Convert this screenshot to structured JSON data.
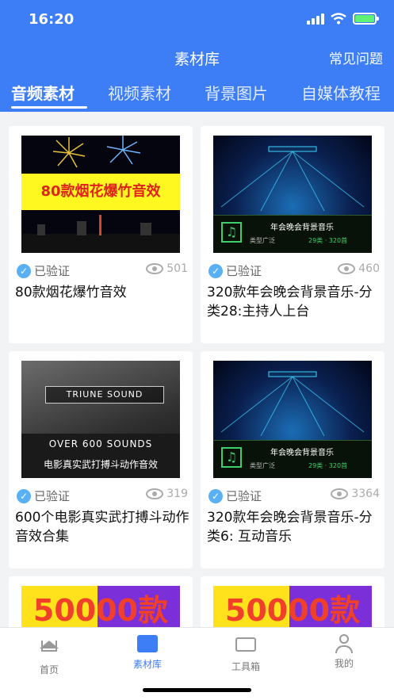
{
  "status_bar": {
    "time": "16:20"
  },
  "nav": {
    "title": "素材库",
    "faq": "常见问题"
  },
  "tabs": [
    {
      "label": "音频素材",
      "active": true
    },
    {
      "label": "视频素材",
      "active": false
    },
    {
      "label": "背景图片",
      "active": false
    },
    {
      "label": "自媒体教程",
      "active": false
    }
  ],
  "cards": [
    {
      "thumb_text": "80款烟花爆竹音效",
      "verified": "已验证",
      "views": "501",
      "title": "80款烟花爆竹音效"
    },
    {
      "thumb_text": "年会晚会背景音乐",
      "thumb_sub1": "类型广泛",
      "thumb_sub2": "29类 · 320首",
      "verified": "已验证",
      "views": "460",
      "title": "320款年会晚会背景音乐-分类28:主持人上台"
    },
    {
      "thumb_text": "TRIUNE SOUND",
      "thumb_sub1": "OVER 600 SOUNDS",
      "thumb_sub2": "电影真实武打搏斗动作音效",
      "verified": "已验证",
      "views": "319",
      "title": "600个电影真实武打搏斗动作音效合集"
    },
    {
      "thumb_text": "年会晚会背景音乐",
      "thumb_sub1": "类型广泛",
      "thumb_sub2": "29类 · 320首",
      "verified": "已验证",
      "views": "3364",
      "title": "320款年会晚会背景音乐-分类6: 互动音乐"
    },
    {
      "thumb_text": "50000款"
    },
    {
      "thumb_text": "50000款"
    }
  ],
  "tabbar": [
    {
      "label": "首页",
      "icon": "home-icon"
    },
    {
      "label": "素材库",
      "icon": "library-icon",
      "active": true
    },
    {
      "label": "工具箱",
      "icon": "toolbox-icon"
    },
    {
      "label": "我的",
      "icon": "profile-icon"
    }
  ],
  "colors": {
    "primary": "#3d7df6",
    "background": "#f2f3f5"
  }
}
